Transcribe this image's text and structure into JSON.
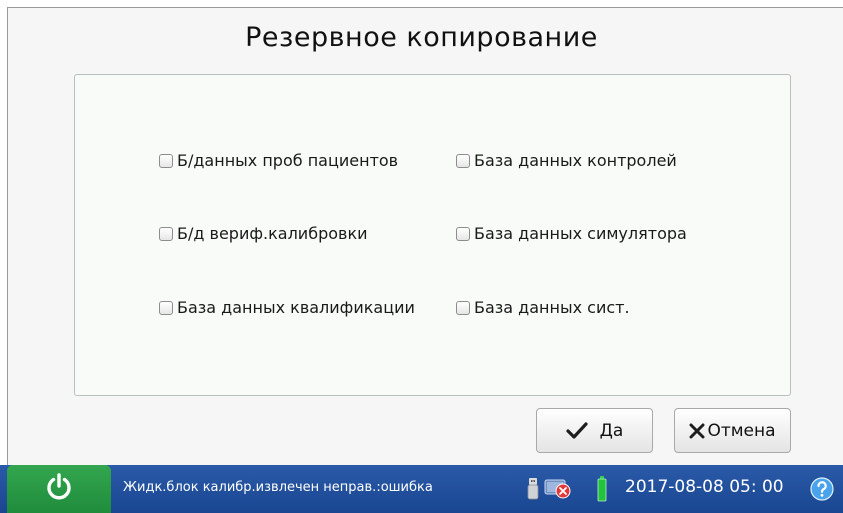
{
  "dialog": {
    "title": "Резервное копирование"
  },
  "options": [
    {
      "label": "Б/данных проб пациентов",
      "checked": false
    },
    {
      "label": "База данных контролей",
      "checked": false
    },
    {
      "label": "Б/д вериф.калибровки",
      "checked": false
    },
    {
      "label": "База данных симулятора",
      "checked": false
    },
    {
      "label": "База данных квалификации",
      "checked": false
    },
    {
      "label": "База данных сист.",
      "checked": false
    }
  ],
  "buttons": {
    "ok_label": "Да",
    "cancel_label": "Отмена"
  },
  "statusbar": {
    "message": "Жидк.блок калибр.извлечен неправ.:ошибка",
    "date": "2017-08-08",
    "time": "05: 00"
  },
  "colors": {
    "statusbar_blue": "#1f4c97",
    "power_green": "#2a9a46",
    "check_green": "#1e1e1e"
  },
  "icons": [
    "power-icon",
    "usb-icon",
    "network-error-icon",
    "battery-icon",
    "help-icon",
    "check-icon",
    "x-icon"
  ]
}
